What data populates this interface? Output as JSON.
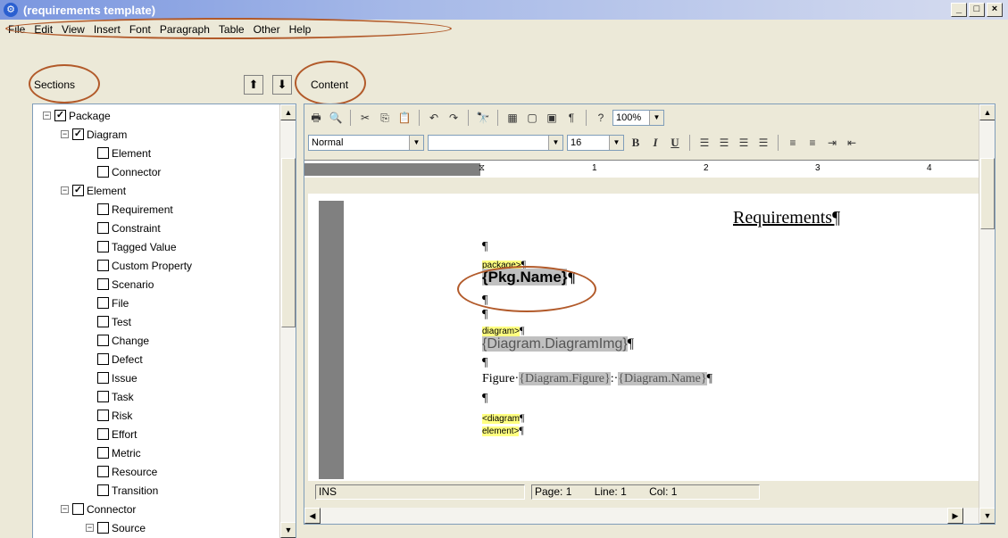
{
  "window": {
    "title": "(requirements template)",
    "min": "_",
    "max": "□",
    "close": "×"
  },
  "menu": [
    "File",
    "Edit",
    "View",
    "Insert",
    "Font",
    "Paragraph",
    "Table",
    "Other",
    "Help"
  ],
  "sections": {
    "label": "Sections",
    "tree": [
      {
        "label": "Package",
        "checked": true,
        "expander": "−",
        "level": 0
      },
      {
        "label": "Diagram",
        "checked": true,
        "expander": "−",
        "level": 1
      },
      {
        "label": "Element",
        "checked": false,
        "expander": "",
        "level": 2
      },
      {
        "label": "Connector",
        "checked": false,
        "expander": "",
        "level": 2
      },
      {
        "label": "Element",
        "checked": true,
        "expander": "−",
        "level": 1
      },
      {
        "label": "Requirement",
        "checked": false,
        "expander": "",
        "level": 2
      },
      {
        "label": "Constraint",
        "checked": false,
        "expander": "",
        "level": 2
      },
      {
        "label": "Tagged Value",
        "checked": false,
        "expander": "",
        "level": 2
      },
      {
        "label": "Custom Property",
        "checked": false,
        "expander": "",
        "level": 2
      },
      {
        "label": "Scenario",
        "checked": false,
        "expander": "",
        "level": 2
      },
      {
        "label": "File",
        "checked": false,
        "expander": "",
        "level": 2
      },
      {
        "label": "Test",
        "checked": false,
        "expander": "",
        "level": 2
      },
      {
        "label": "Change",
        "checked": false,
        "expander": "",
        "level": 2
      },
      {
        "label": "Defect",
        "checked": false,
        "expander": "",
        "level": 2
      },
      {
        "label": "Issue",
        "checked": false,
        "expander": "",
        "level": 2
      },
      {
        "label": "Task",
        "checked": false,
        "expander": "",
        "level": 2
      },
      {
        "label": "Risk",
        "checked": false,
        "expander": "",
        "level": 2
      },
      {
        "label": "Effort",
        "checked": false,
        "expander": "",
        "level": 2
      },
      {
        "label": "Metric",
        "checked": false,
        "expander": "",
        "level": 2
      },
      {
        "label": "Resource",
        "checked": false,
        "expander": "",
        "level": 2
      },
      {
        "label": "Transition",
        "checked": false,
        "expander": "",
        "level": 2
      },
      {
        "label": "Connector",
        "checked": false,
        "expander": "−",
        "level": 1
      },
      {
        "label": "Source",
        "checked": false,
        "expander": "−",
        "level": 2
      }
    ]
  },
  "content": {
    "label": "Content",
    "zoom": "100%",
    "style": "Normal",
    "font": "",
    "size": "16",
    "ruler": [
      "1",
      "2",
      "3",
      "4"
    ],
    "doc": {
      "heading": "Requirements¶",
      "pilcrow": "¶",
      "package_tag": "package>",
      "pkg_name": "{Pkg.Name}",
      "diagram_tag": "diagram>",
      "diagram_img": "{Diagram.DiagramImg}",
      "figure_prefix": "Figure·",
      "figure_field": "{Diagram.Figure}",
      "figure_sep": ":·",
      "name_field": "{Diagram.Name}",
      "end_diagram_tag": "<diagram",
      "element_tag": "element>"
    },
    "status": {
      "mode": "INS",
      "page": "Page: 1",
      "line": "Line: 1",
      "col": "Col: 1"
    }
  },
  "accent_color": "#b25a2a"
}
